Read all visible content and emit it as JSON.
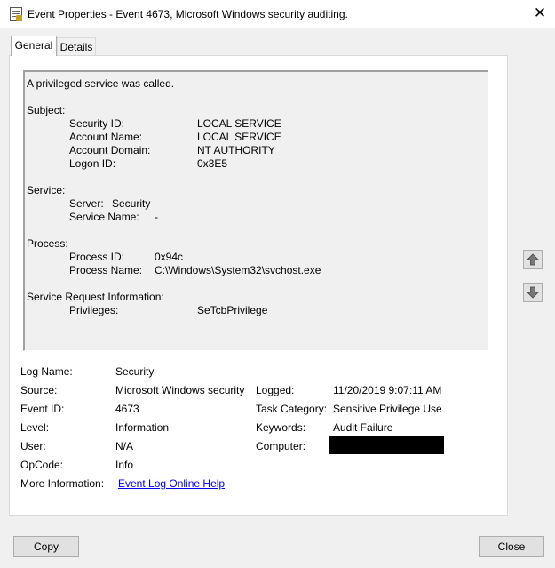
{
  "window": {
    "title": "Event Properties - Event 4673, Microsoft Windows security auditing.",
    "close_glyph": "✕"
  },
  "tabs": [
    {
      "label": "General",
      "active": true
    },
    {
      "label": "Details",
      "active": false
    }
  ],
  "description": {
    "heading": "A privileged service was called.",
    "subject_label": "Subject:",
    "security_id_label": "Security ID:",
    "security_id": "LOCAL SERVICE",
    "account_name_label": "Account Name:",
    "account_name": "LOCAL SERVICE",
    "account_domain_label": "Account Domain:",
    "account_domain": "NT AUTHORITY",
    "logon_id_label": "Logon ID:",
    "logon_id": "0x3E5",
    "service_label": "Service:",
    "server_label": "Server:",
    "server": "Security",
    "service_name_label": "Service Name:",
    "service_name": "-",
    "process_label": "Process:",
    "process_id_label": "Process ID:",
    "process_id": "0x94c",
    "process_name_label": "Process Name:",
    "process_name": "C:\\Windows\\System32\\svchost.exe",
    "sri_label": "Service Request Information:",
    "privileges_label": "Privileges:",
    "privileges": "SeTcbPrivilege"
  },
  "fields": {
    "log_name_label": "Log Name:",
    "log_name": "Security",
    "source_label": "Source:",
    "source": "Microsoft Windows security",
    "logged_label": "Logged:",
    "logged": "11/20/2019 9:07:11 AM",
    "event_id_label": "Event ID:",
    "event_id": "4673",
    "task_category_label": "Task Category:",
    "task_category": "Sensitive Privilege Use",
    "level_label": "Level:",
    "level": "Information",
    "keywords_label": "Keywords:",
    "keywords": "Audit Failure",
    "user_label": "User:",
    "user": "N/A",
    "computer_label": "Computer:",
    "opcode_label": "OpCode:",
    "opcode": "Info",
    "more_info_label": "More Information:",
    "more_info_link": "Event Log Online Help"
  },
  "buttons": {
    "copy": "Copy",
    "close": "Close",
    "up_icon": "arrow-up-icon",
    "down_icon": "arrow-down-icon"
  },
  "colors": {
    "link": "#0000ee",
    "redaction": "#000000",
    "arrow": "#777777"
  }
}
